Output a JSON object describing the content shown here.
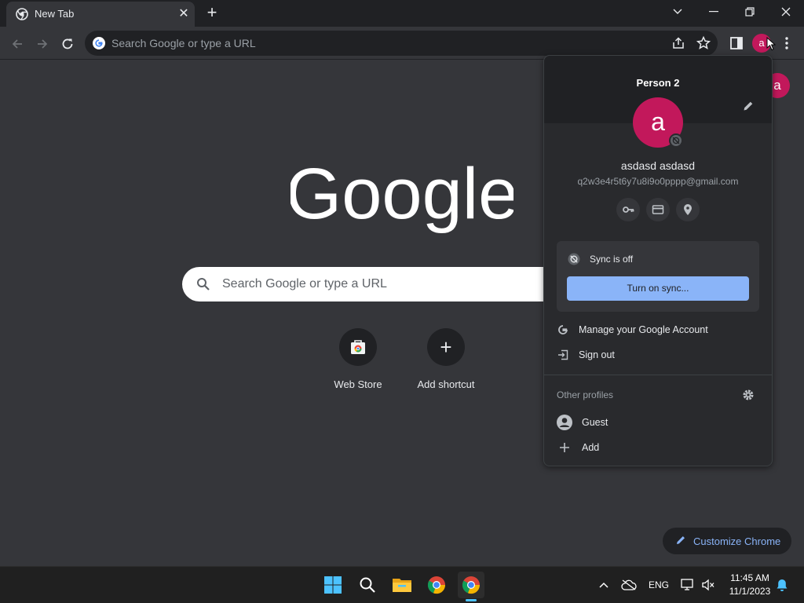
{
  "tab": {
    "title": "New Tab",
    "close_glyph": "✕",
    "new_tab_glyph": "+"
  },
  "omnibox": {
    "placeholder": "Search Google or type a URL"
  },
  "toolbar": {
    "avatar_letter": "a"
  },
  "ntp": {
    "logo_text": "Google",
    "search_placeholder": "Search Google or type a URL",
    "shortcuts": [
      {
        "label": "Web Store",
        "icon": "web-store-icon"
      },
      {
        "label": "Add shortcut",
        "icon": "plus-icon",
        "glyph": "+"
      }
    ],
    "corner_avatar_letter": "a",
    "customize_label": "Customize Chrome"
  },
  "profile_menu": {
    "title": "Person 2",
    "avatar_letter": "a",
    "name": "asdasd asdasd",
    "email": "q2w3e4r5t6y7u8i9o0pppp@gmail.com",
    "quick_icons": [
      "key-icon",
      "credit-card-icon",
      "location-pin-icon"
    ],
    "sync_status": "Sync is off",
    "sync_button": "Turn on sync...",
    "manage_account": "Manage your Google Account",
    "sign_out": "Sign out",
    "other_profiles_label": "Other profiles",
    "guest_label": "Guest",
    "add_label": "Add"
  },
  "taskbar": {
    "language": "ENG",
    "time": "11:45 AM",
    "date": "11/1/2023"
  },
  "colors": {
    "background": "#35363a",
    "frame": "#202124",
    "accent": "#8ab4f8",
    "avatar": "#c2185b"
  }
}
